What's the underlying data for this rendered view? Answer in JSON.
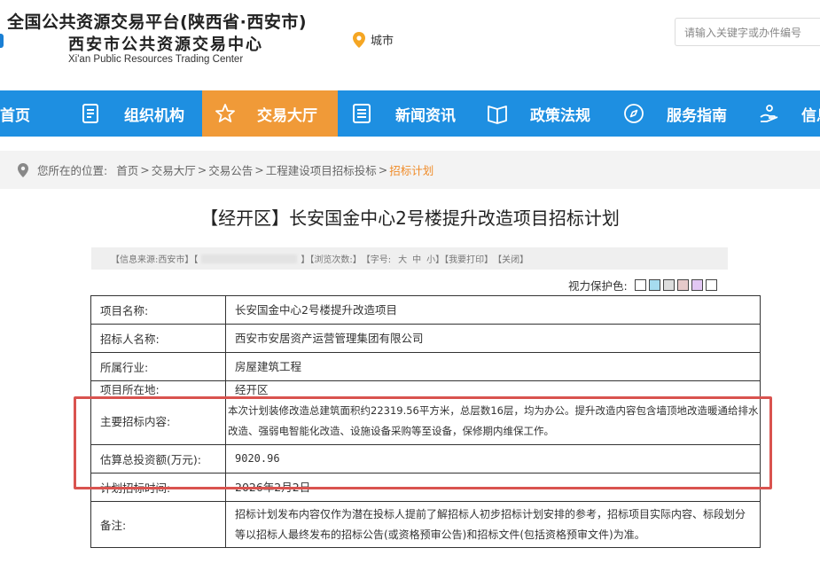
{
  "header": {
    "title": "全国公共资源交易平台(陕西省·西安市)",
    "subtitle": "西安市公共资源交易中心",
    "subtitle_en": "Xi'an Public Resources Trading Center",
    "city_label": "城市",
    "search_placeholder": "请输入关键字或办件编号"
  },
  "nav": {
    "items": [
      {
        "label": "首页",
        "icon": "home-icon"
      },
      {
        "label": "组织机构",
        "icon": "document-icon"
      },
      {
        "label": "交易大厅",
        "icon": "star-icon"
      },
      {
        "label": "新闻资讯",
        "icon": "list-icon"
      },
      {
        "label": "政策法规",
        "icon": "book-icon"
      },
      {
        "label": "服务指南",
        "icon": "compass-icon"
      },
      {
        "label": "信息",
        "icon": "hand-icon"
      }
    ],
    "active_color": "#f09a38",
    "bar_color": "#1e8fe1"
  },
  "breadcrumb": {
    "prefix": "您所在的位置:",
    "items": [
      "首页",
      "交易大厅",
      "交易公告",
      "工程建设项目招标投标",
      "招标计划"
    ],
    "current_color": "#f08c2a"
  },
  "article": {
    "title": "【经开区】长安国金中心2号楼提升改造项目招标计划",
    "info": {
      "source": "【信息来源:西安市】【",
      "views": "】【浏览次数:】",
      "fontsize": "【字号:",
      "size_large": "大",
      "size_medium": "中",
      "size_small": "小",
      "print": "】【我要打印】",
      "close": "【关闭】"
    },
    "eye_label": "视力保护色:",
    "eye_colors": [
      "#ffffff",
      "#a6dcef",
      "#dddddd",
      "#e6c9c9",
      "#e2c7f3",
      "#ffffff"
    ]
  },
  "table": {
    "rows": [
      {
        "key": "项目名称:",
        "value": "长安国金中心2号楼提升改造项目"
      },
      {
        "key": "招标人名称:",
        "value": "西安市安居资产运营管理集团有限公司"
      },
      {
        "key": "所属行业:",
        "value": "房屋建筑工程"
      },
      {
        "key": "项目所在地:",
        "value": "经开区"
      },
      {
        "key": "主要招标内容:",
        "value": "本次计划装修改造总建筑面积约22319.56平方米，总层数16层，均为办公。提升改造内容包含墙顶地改造暖通给排水改造、强弱电智能化改造、设施设备采购等至设备，保修期内维保工作。"
      },
      {
        "key": "估算总投资额(万元):",
        "value": "9020.96"
      },
      {
        "key": "计划招标时间:",
        "value": "2026年2月2日"
      },
      {
        "key": "备注:",
        "value": "招标计划发布内容仅作为潜在投标人提前了解招标人初步招标计划安排的参考，招标项目实际内容、标段划分等以招标人最终发布的招标公告(或资格预审公告)和招标文件(包括资格预审文件)为准。"
      }
    ]
  }
}
